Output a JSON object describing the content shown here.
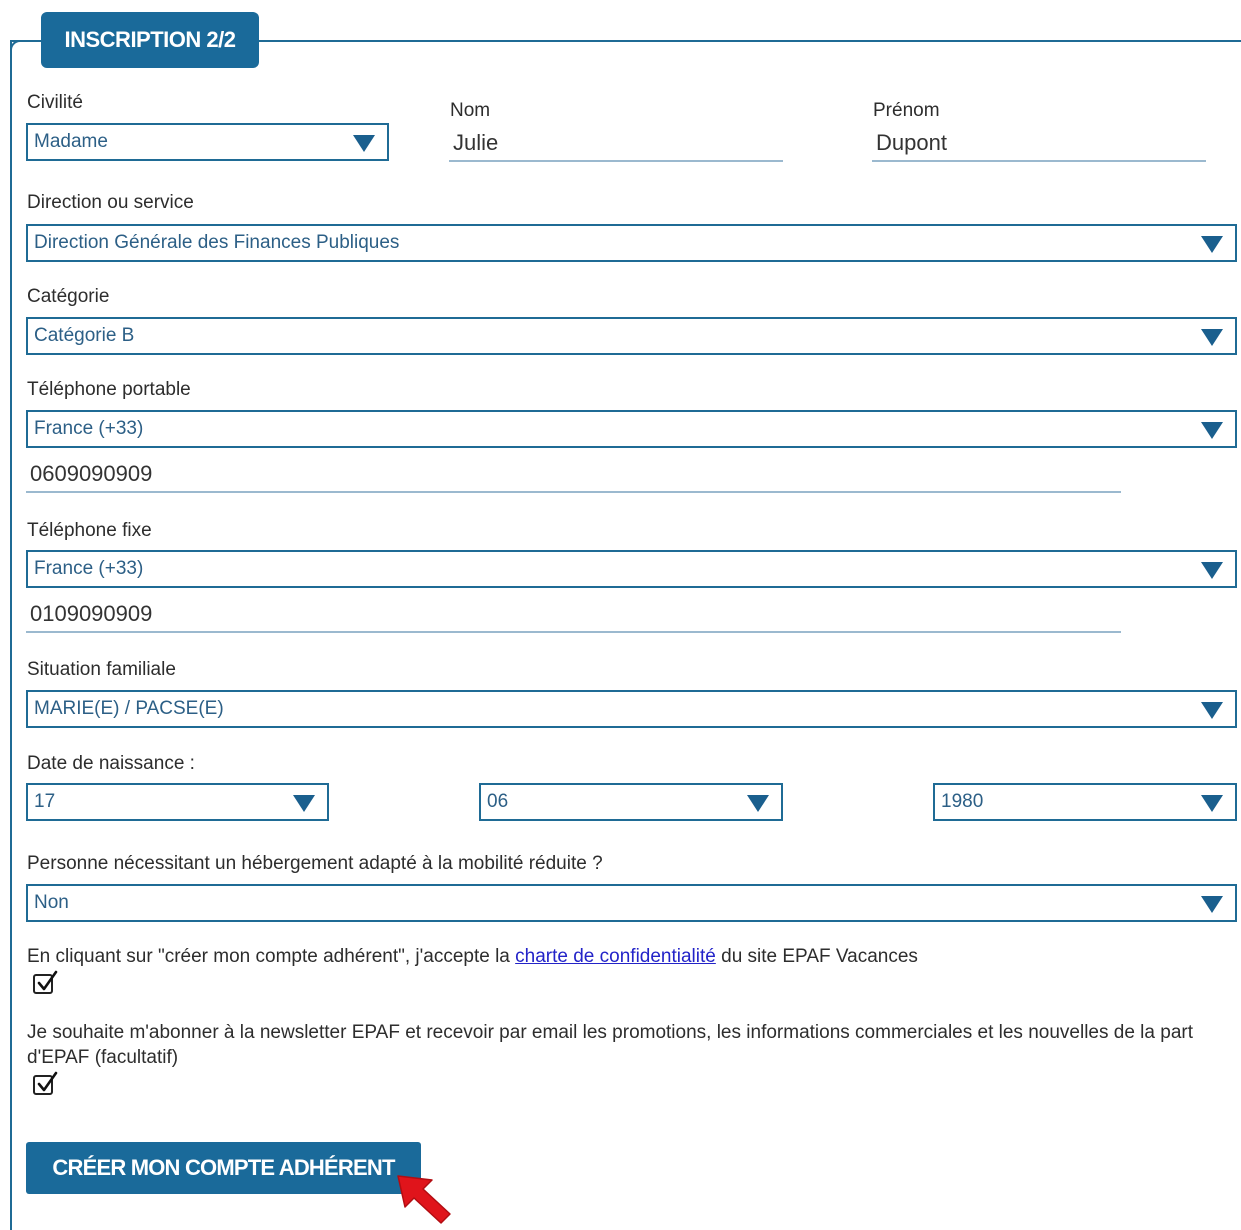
{
  "legend": "INSCRIPTION 2/2",
  "civilite": {
    "label": "Civilité",
    "value": "Madame"
  },
  "nom": {
    "label": "Nom",
    "value": "Julie"
  },
  "prenom": {
    "label": "Prénom",
    "value": "Dupont"
  },
  "direction": {
    "label": "Direction ou service",
    "value": "Direction Générale des Finances Publiques"
  },
  "categorie": {
    "label": "Catégorie",
    "value": "Catégorie B"
  },
  "tel_portable": {
    "label": "Téléphone portable",
    "country": "France (+33)",
    "number": "0609090909"
  },
  "tel_fixe": {
    "label": "Téléphone fixe",
    "country": "France (+33)",
    "number": "0109090909"
  },
  "situation": {
    "label": "Situation familiale",
    "value": "MARIE(E) / PACSE(E)"
  },
  "naissance": {
    "label": "Date de naissance :",
    "day": "17",
    "month": "06",
    "year": "1980"
  },
  "mobilite": {
    "label": "Personne nécessitant un hébergement adapté à la mobilité réduite ?",
    "value": "Non"
  },
  "consent": {
    "text_before": "En cliquant sur \"créer mon compte adhérent\", j'accepte la",
    "link": "charte de confidentialité",
    "text_after": "du site EPAF Vacances",
    "checked": true
  },
  "newsletter": {
    "text": "Je souhaite m'abonner à la newsletter EPAF et recevoir par email les promotions, les informations commerciales et les nouvelles de la part d'EPAF (facultatif)",
    "checked": true
  },
  "submit_label": "CRÉER MON COMPTE ADHÉRENT",
  "colors": {
    "primary": "#1a6a9a",
    "link": "#2323c8",
    "pointer": "#e0141b"
  },
  "icons": [
    "dropdown-arrow-icon",
    "checkmark-icon",
    "pointer-arrow-icon"
  ]
}
